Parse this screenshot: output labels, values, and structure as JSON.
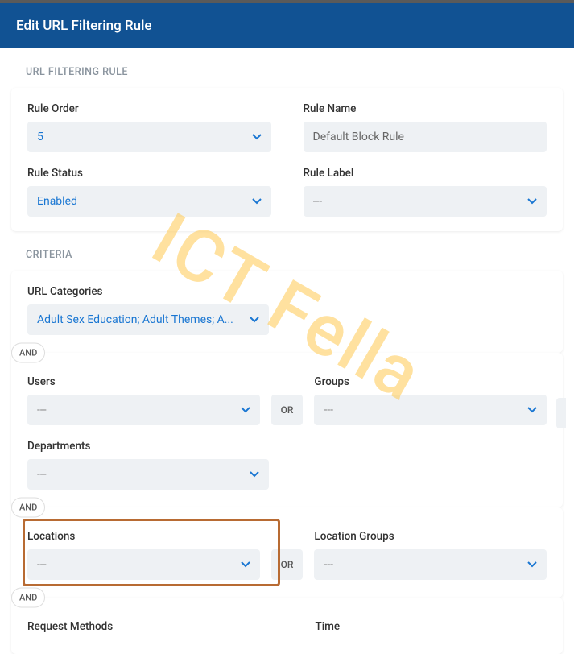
{
  "header": {
    "title": "Edit URL Filtering Rule"
  },
  "sections": {
    "rule": {
      "label": "URL FILTERING RULE",
      "order_label": "Rule Order",
      "order_value": "5",
      "name_label": "Rule Name",
      "name_value": "Default Block Rule",
      "status_label": "Rule Status",
      "status_value": "Enabled",
      "label_label": "Rule Label",
      "label_value": "---"
    },
    "criteria": {
      "label": "CRITERIA",
      "categories_label": "URL Categories",
      "categories_value": "Adult Sex Education; Adult Themes; A...",
      "users_label": "Users",
      "users_value": "---",
      "groups_label": "Groups",
      "groups_value": "---",
      "departments_label": "Departments",
      "departments_value": "---",
      "locations_label": "Locations",
      "locations_value": "---",
      "locgroups_label": "Location Groups",
      "locgroups_value": "---",
      "methods_label": "Request Methods",
      "time_label": "Time"
    }
  },
  "badges": {
    "and": "AND",
    "or": "OR"
  },
  "watermark": "ICT Fella"
}
